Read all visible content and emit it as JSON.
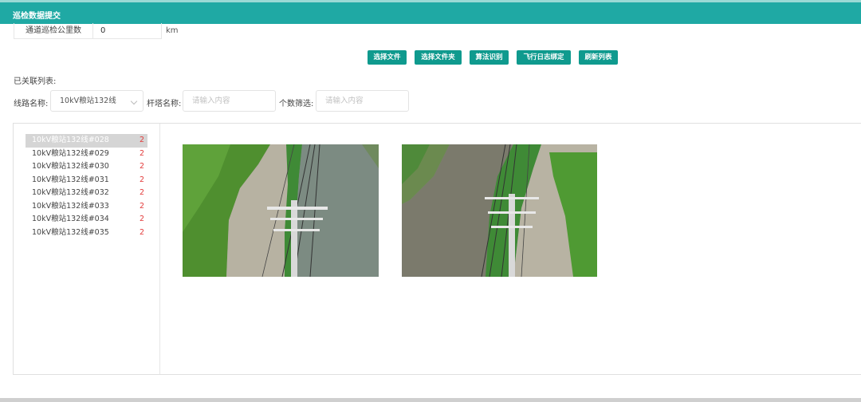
{
  "window": {
    "title": "巡检数据提交"
  },
  "mileage": {
    "label": "通道巡检公里数",
    "value": "0",
    "unit": "km"
  },
  "toolbar": {
    "buttons": [
      {
        "label": "选择文件"
      },
      {
        "label": "选择文件夹"
      },
      {
        "label": "算法识别"
      },
      {
        "label": "飞行日志绑定"
      },
      {
        "label": "刷新列表"
      }
    ]
  },
  "list_title": "已关联列表:",
  "filters": {
    "line_label": "线路名称:",
    "line_value": "10kV粮站132线",
    "tower_label": "杆塔名称:",
    "tower_placeholder": "请输入内容",
    "count_label": "个数筛选:",
    "count_placeholder": "请输入内容"
  },
  "towers": [
    {
      "name": "10kV粮站132线#028",
      "count": "2"
    },
    {
      "name": "10kV粮站132线#029",
      "count": "2"
    },
    {
      "name": "10kV粮站132线#030",
      "count": "2"
    },
    {
      "name": "10kV粮站132线#031",
      "count": "2"
    },
    {
      "name": "10kV粮站132线#032",
      "count": "2"
    },
    {
      "name": "10kV粮站132线#033",
      "count": "2"
    },
    {
      "name": "10kV粮站132线#034",
      "count": "2"
    },
    {
      "name": "10kV粮站132线#035",
      "count": "2"
    }
  ],
  "colors": {
    "header": "#1fa9a4",
    "button": "#0f9a8e",
    "count": "#e23b3b"
  }
}
